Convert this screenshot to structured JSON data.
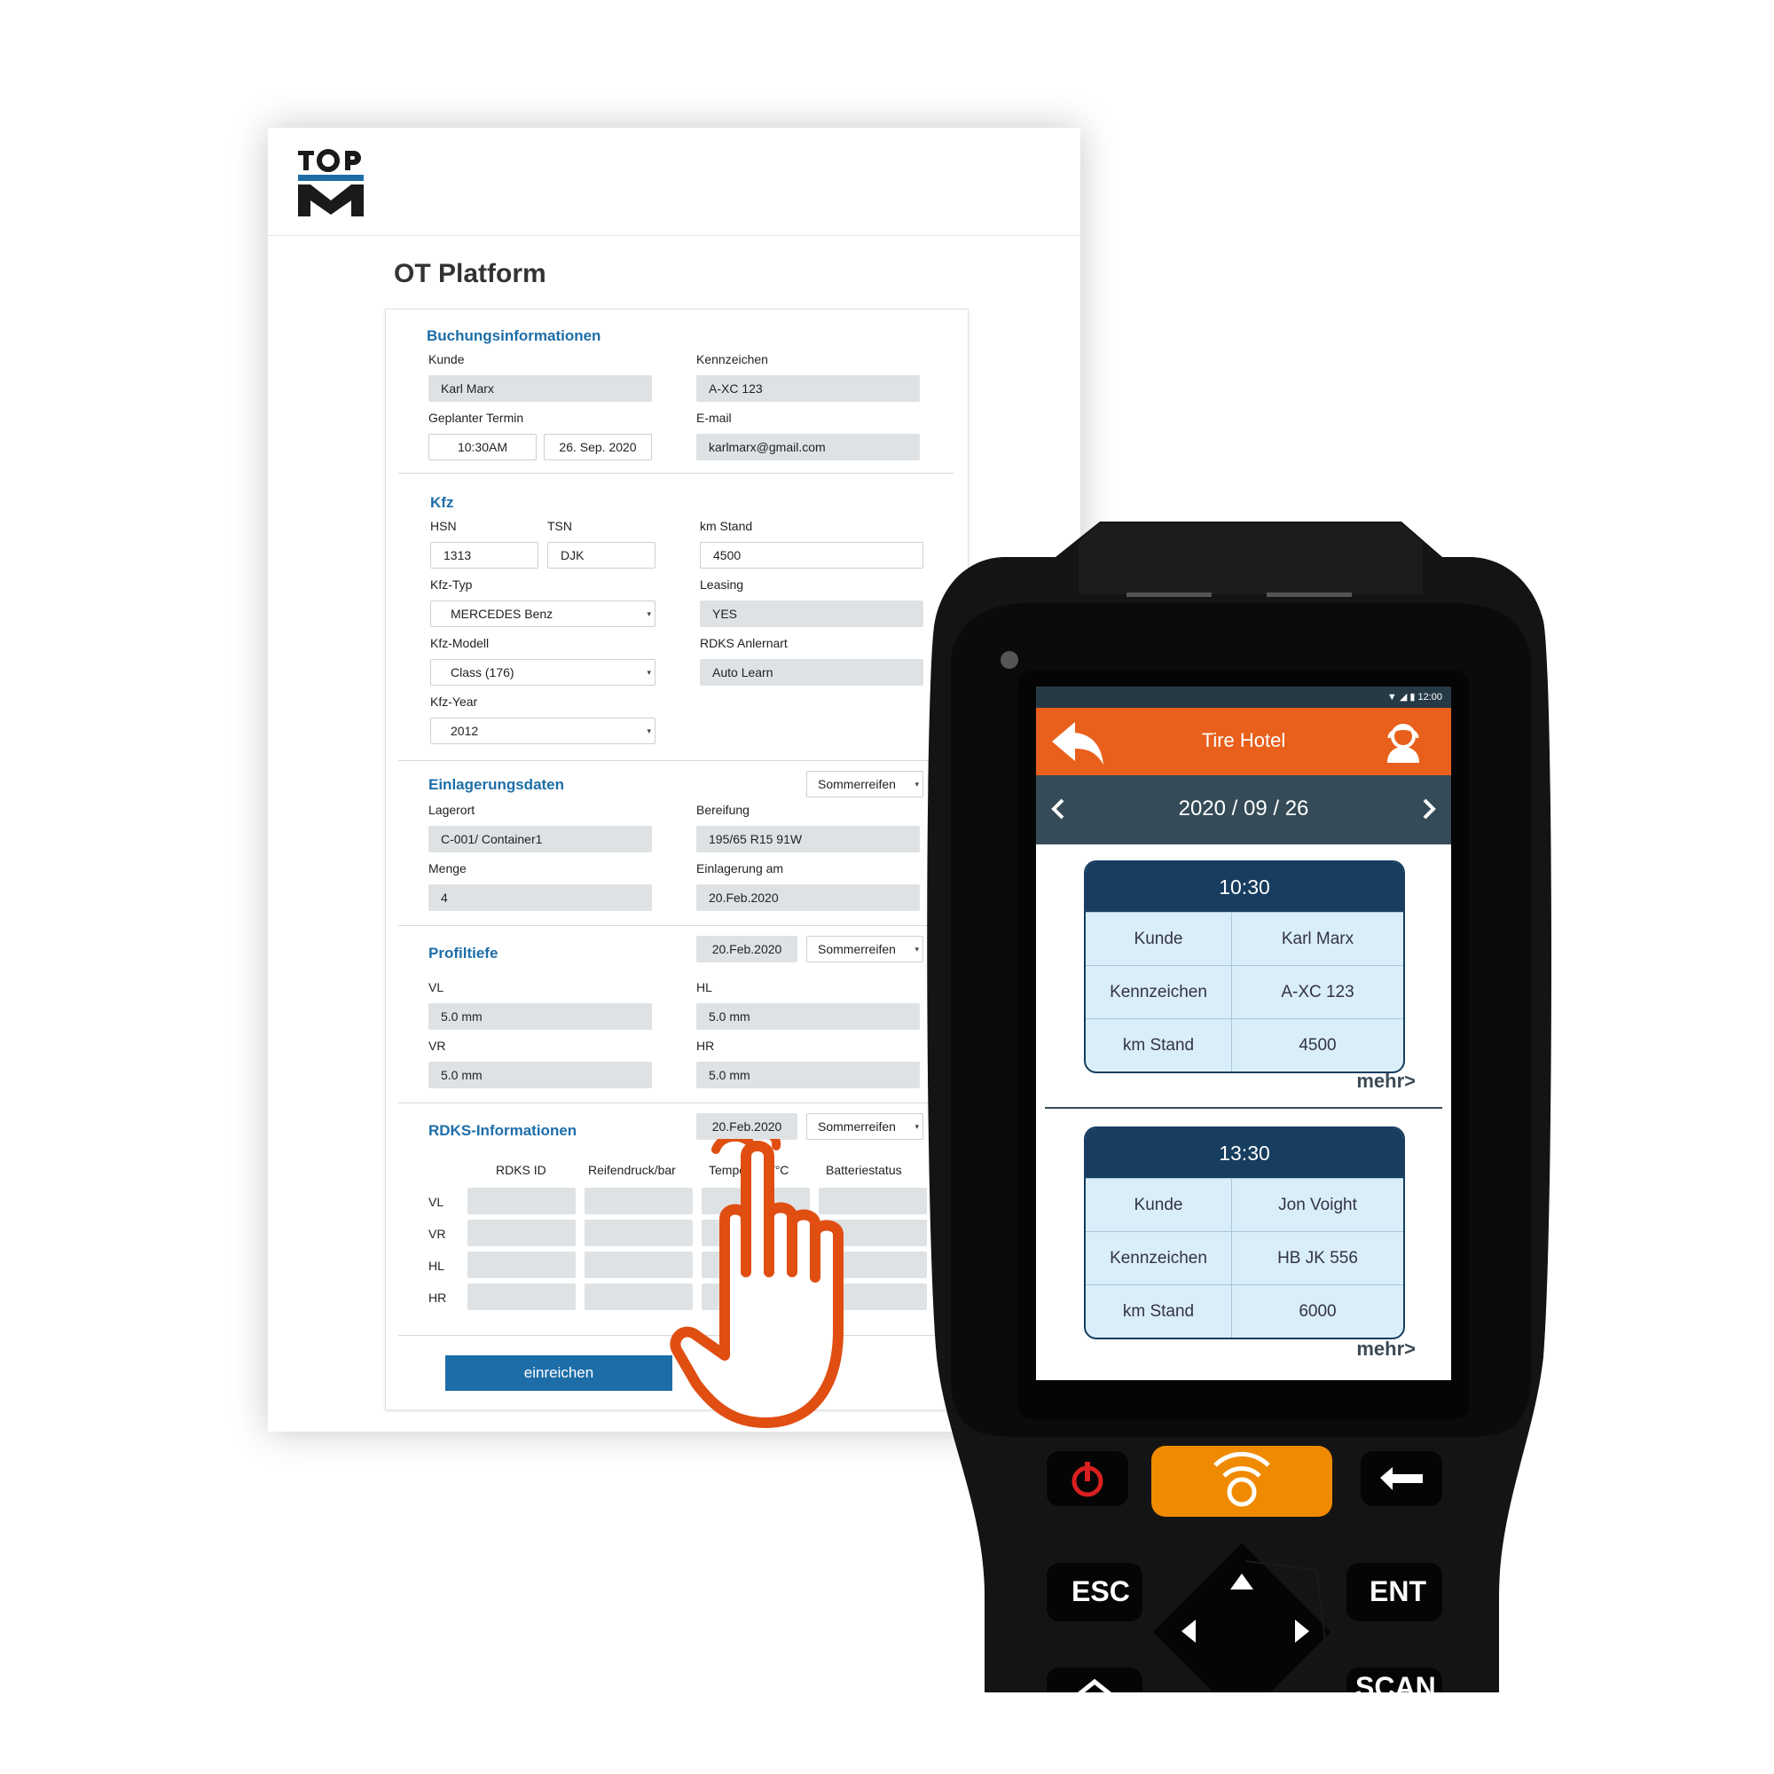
{
  "web": {
    "title": "OT Platform",
    "booking": {
      "section": "Buchungsinformationen",
      "kunde_label": "Kunde",
      "kunde": "Karl Marx",
      "kennzeichen_label": "Kennzeichen",
      "kennzeichen": "A-XC 123",
      "termin_label": "Geplanter Termin",
      "time": "10:30AM",
      "date": "26. Sep. 2020",
      "email_label": "E-mail",
      "email": "karlmarx@gmail.com"
    },
    "kfz": {
      "section": "Kfz",
      "hsn_label": "HSN",
      "hsn": "1313",
      "tsn_label": "TSN",
      "tsn": "DJK",
      "km_label": "km Stand",
      "km": "4500",
      "typ_label": "Kfz-Typ",
      "typ": "MERCEDES Benz",
      "leasing_label": "Leasing",
      "leasing": "YES",
      "modell_label": "Kfz-Modell",
      "modell": "Class (176)",
      "rdks_label": "RDKS Anlernart",
      "rdks": "Auto Learn",
      "year_label": "Kfz-Year",
      "year": "2012"
    },
    "storage": {
      "section": "Einlagerungsdaten",
      "season": "Sommerreifen",
      "lagerort_label": "Lagerort",
      "lagerort": "C-001/ Container1",
      "bereifung_label": "Bereifung",
      "bereifung": "195/65 R15 91W",
      "menge_label": "Menge",
      "menge": "4",
      "einlagerung_label": "Einlagerung  am",
      "einlagerung": "20.Feb.2020"
    },
    "profile": {
      "section": "Profiltiefe",
      "date": "20.Feb.2020",
      "season": "Sommerreifen",
      "vl_label": "VL",
      "vl": "5.0 mm",
      "hl_label": "HL",
      "hl": "5.0 mm",
      "vr_label": "VR",
      "vr": "5.0 mm",
      "hr_label": "HR",
      "hr": "5.0 mm"
    },
    "rdks": {
      "section": "RDKS-Informationen",
      "date": "20.Feb.2020",
      "season": "Sommerreifen",
      "columns": [
        "RDKS ID",
        "Reifendruck/bar",
        "Temperatur/°C",
        "Batteriestatus"
      ],
      "rows": [
        "VL",
        "VR",
        "HL",
        "HR"
      ]
    },
    "submit": "einreichen"
  },
  "device": {
    "status_time": "12:00",
    "app_title": "Tire Hotel",
    "date": "2020 / 09 / 26",
    "appointments": [
      {
        "time": "10:30",
        "kunde_label": "Kunde",
        "kunde": "Karl Marx",
        "kz_label": "Kennzeichen",
        "kz": "A-XC 123",
        "km_label": "km Stand",
        "km": "4500",
        "more": "mehr>"
      },
      {
        "time": "13:30",
        "kunde_label": "Kunde",
        "kunde": "Jon Voight",
        "kz_label": "Kennzeichen",
        "kz": "HB JK 556",
        "km_label": "km Stand",
        "km": "6000",
        "more": "mehr>"
      }
    ],
    "keys": {
      "esc": "ESC",
      "ent": "ENT",
      "scan": "SCAN"
    }
  },
  "colors": {
    "accent": "#e8601c",
    "navy": "#173d5f",
    "link": "#1d6ea8",
    "scan_key": "#f08a00"
  }
}
